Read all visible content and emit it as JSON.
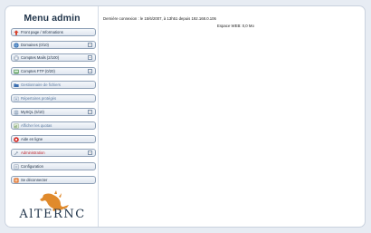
{
  "sidebar": {
    "title": "Menu admin",
    "items": [
      {
        "label": "Front page / Informations",
        "icon": "arrow-up-icon",
        "expandable": false,
        "style": "normal"
      },
      {
        "label": "Domaines (0/10)",
        "icon": "globe-icon",
        "expandable": true,
        "style": "normal"
      },
      {
        "label": "Comptes Mails (2/100)",
        "icon": "mail-icon",
        "expandable": true,
        "style": "normal"
      },
      {
        "label": "Comptes FTP (0/20)",
        "icon": "ftp-icon",
        "expandable": true,
        "style": "normal"
      },
      {
        "label": "Gestionnaire de fichiers",
        "icon": "folder-icon",
        "expandable": false,
        "style": "muted"
      },
      {
        "label": "Répertoires protégés",
        "icon": "lock-folder-icon",
        "expandable": false,
        "style": "muted"
      },
      {
        "label": "MySQL (5/10)",
        "icon": "database-icon",
        "expandable": true,
        "style": "normal"
      },
      {
        "label": "Afficher les quotas",
        "icon": "quota-icon",
        "expandable": false,
        "style": "muted"
      },
      {
        "label": "Aide en ligne",
        "icon": "help-icon",
        "expandable": false,
        "style": "normal"
      },
      {
        "label": "Administration",
        "icon": "admin-icon",
        "expandable": true,
        "style": "admin"
      },
      {
        "label": "Configuration",
        "icon": "config-icon",
        "expandable": false,
        "style": "normal"
      },
      {
        "label": "Se déconnecter",
        "icon": "logout-icon",
        "expandable": false,
        "style": "normal"
      }
    ],
    "logo_text": "AlTERNC"
  },
  "main": {
    "last_login": "Dernière connexion : le 15/6/2007, à 13h51 depuis 192.168.0.106",
    "web_space": "Espace WEB: 0,0 Mo"
  },
  "colors": {
    "page_bg": "#e7ecf3",
    "accent": "#1f3349",
    "admin_red": "#c0242b",
    "logo_orange": "#e08a2c"
  }
}
